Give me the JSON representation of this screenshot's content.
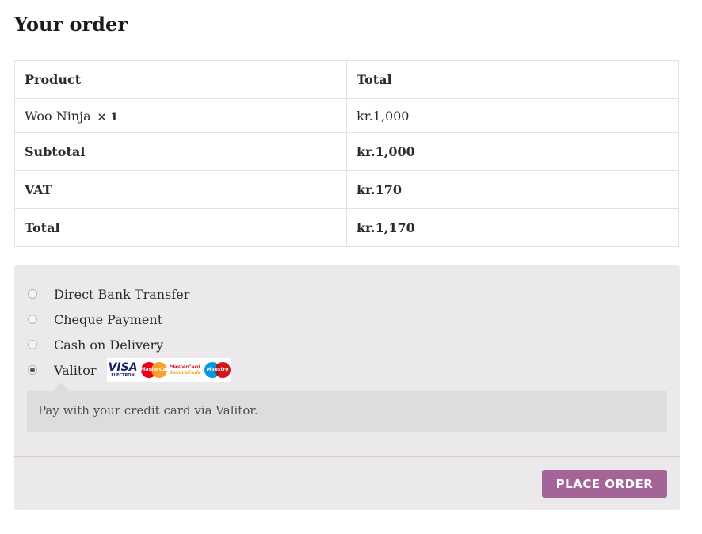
{
  "heading": "Your order",
  "table": {
    "headers": [
      "Product",
      "Total"
    ],
    "item": {
      "name": "Woo Ninja",
      "qty": "× 1",
      "total": "kr.1,000"
    },
    "rows": [
      {
        "label": "Subtotal",
        "value": "kr.1,000"
      },
      {
        "label": "VAT",
        "value": "kr.170"
      },
      {
        "label": "Total",
        "value": "kr.1,170"
      }
    ]
  },
  "payment": {
    "methods": [
      {
        "label": "Direct Bank Transfer",
        "selected": false
      },
      {
        "label": "Cheque Payment",
        "selected": false
      },
      {
        "label": "Cash on Delivery",
        "selected": false
      },
      {
        "label": "Valitor",
        "selected": true
      }
    ],
    "card_logos": {
      "visa": "VISA",
      "visa_sub": "ELECTRON",
      "mastercard": "MasterCard",
      "securecode_1": "MasterCard.",
      "securecode_2": "SecureCode",
      "maestro": "Maestro"
    },
    "description": "Pay with your credit card via Valitor."
  },
  "place_order_label": "PLACE ORDER",
  "colors": {
    "accent": "#a46497",
    "panel": "#ebe9eb",
    "description_box": "#dfdcde"
  }
}
